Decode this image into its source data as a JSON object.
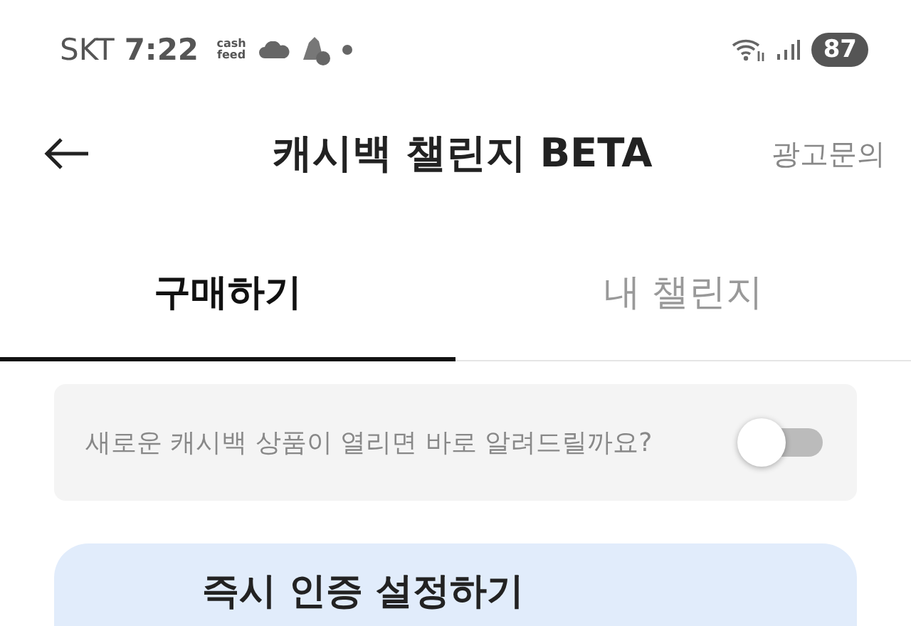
{
  "status_bar": {
    "carrier": "SKT",
    "time": "7:22",
    "app_badge": "cash feed",
    "battery": "87"
  },
  "header": {
    "title": "캐시백 챌린지 BETA",
    "action": "광고문의"
  },
  "tabs": [
    {
      "label": "구매하기",
      "selected": true
    },
    {
      "label": "내 챌린지",
      "selected": false
    }
  ],
  "notice": {
    "text": "새로운 캐시백 상품이 열리면 바로 알려드릴까요?",
    "on": false
  },
  "card": {
    "title": "즉시 인증 설정하기"
  }
}
